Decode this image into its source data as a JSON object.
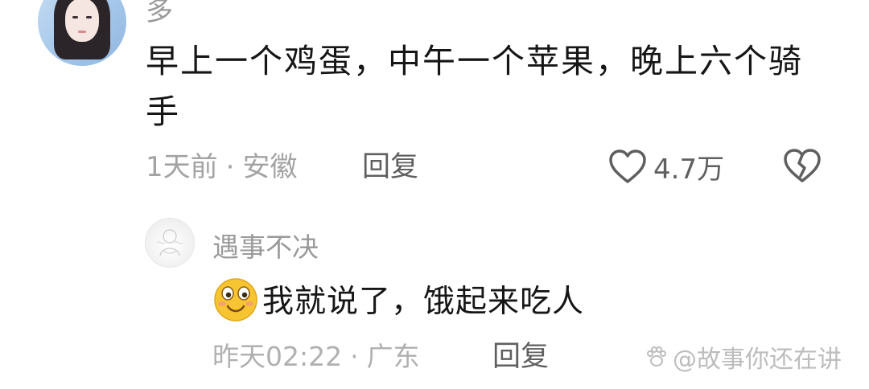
{
  "comment": {
    "username": "多",
    "text": "早上一个鸡蛋，中午一个苹果，晚上六个骑手",
    "time": "1天前",
    "separator": "·",
    "location": "安徽",
    "reply_label": "回复",
    "like_count": "4.7万",
    "avatar_icon": "avatar-woman-icon",
    "like_icon": "heart-outline-icon",
    "dislike_icon": "broken-heart-icon"
  },
  "reply": {
    "username": "遇事不决",
    "emoji_icon": "smiley-emoji-icon",
    "text": "我就说了，饿起来吃人",
    "time": "昨天02:22",
    "separator": "·",
    "location": "广东",
    "reply_label": "回复",
    "avatar_icon": "avatar-sketch-icon"
  },
  "watermark": {
    "text": "@故事你还在讲",
    "icon": "paw-icon"
  },
  "colors": {
    "primary_text": "#161616",
    "secondary_text": "#a3a3a3",
    "action_text": "#5f5f5f"
  }
}
